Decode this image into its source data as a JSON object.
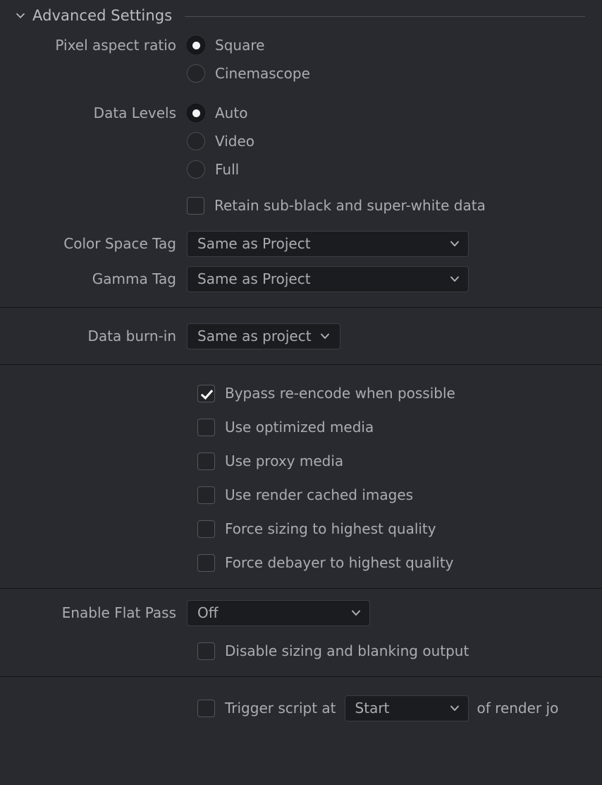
{
  "header": {
    "title": "Advanced Settings",
    "toggle_icon": "chevron-down-icon",
    "expanded": true
  },
  "groups": {
    "pixel_aspect_ratio": {
      "label": "Pixel aspect ratio",
      "selected": "Square",
      "options": [
        {
          "label": "Square",
          "checked": true
        },
        {
          "label": "Cinemascope",
          "checked": false
        }
      ]
    },
    "data_levels": {
      "label": "Data Levels",
      "selected": "Auto",
      "options": [
        {
          "label": "Auto",
          "checked": true
        },
        {
          "label": "Video",
          "checked": false
        },
        {
          "label": "Full",
          "checked": false
        }
      ],
      "extra_checkbox": {
        "label": "Retain sub-black and super-white data",
        "checked": false
      }
    },
    "color_space_tag": {
      "label": "Color Space Tag",
      "value": "Same as Project",
      "chevron_icon": "chevron-down-icon"
    },
    "gamma_tag": {
      "label": "Gamma Tag",
      "value": "Same as Project",
      "chevron_icon": "chevron-down-icon"
    },
    "data_burn_in": {
      "label": "Data burn-in",
      "value": "Same as project",
      "chevron_icon": "chevron-down-icon"
    },
    "render_options": {
      "checkboxes": [
        {
          "label": "Bypass re-encode when possible",
          "checked": true
        },
        {
          "label": "Use optimized media",
          "checked": false
        },
        {
          "label": "Use proxy media",
          "checked": false
        },
        {
          "label": "Use render cached images",
          "checked": false
        },
        {
          "label": "Force sizing to highest quality",
          "checked": false
        },
        {
          "label": "Force debayer to highest quality",
          "checked": false
        }
      ]
    },
    "flat_pass": {
      "label": "Enable Flat Pass",
      "value": "Off",
      "chevron_icon": "chevron-down-icon",
      "checkbox": {
        "label": "Disable sizing and blanking output",
        "checked": false
      }
    },
    "trigger_script": {
      "checkbox_checked": false,
      "text_before": "Trigger script at",
      "value": "Start",
      "chevron_icon": "chevron-down-icon",
      "text_after": "of render jo"
    }
  },
  "colors": {
    "background": "#292a2f",
    "text": "#a9adb3",
    "title": "#b9bcc1",
    "control_fill": "#1b1c1f",
    "control_border": "#3b3d42",
    "divider": "#131417",
    "header_rule": "#4c4e54",
    "check_mark": "#ffffff"
  }
}
